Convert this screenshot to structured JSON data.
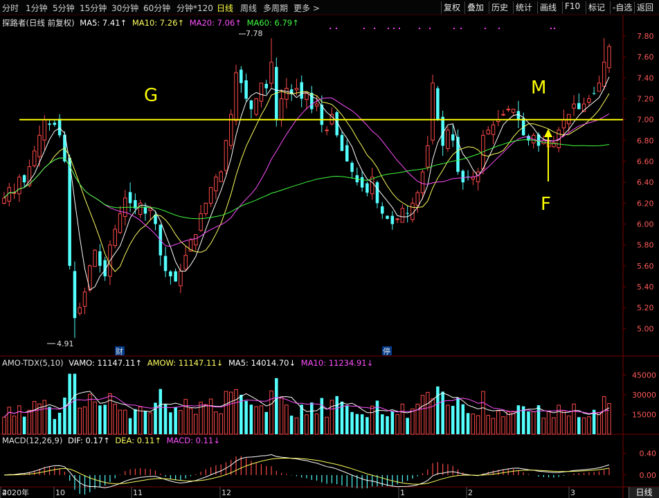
{
  "toolbar": {
    "periods": [
      "分时",
      "1分钟",
      "5分钟",
      "15分钟",
      "30分钟",
      "60分钟",
      "分钟*120",
      "日线",
      "周线",
      "多周期",
      "更多 >"
    ],
    "active": "日线",
    "right": [
      "复权",
      "叠加",
      "历史",
      "统计",
      "画线",
      "F10",
      "标记",
      "-自选",
      "返回"
    ]
  },
  "main_legend": {
    "title": "探路者(日线 前复权)",
    "ma5": "MA5: 7.41↑",
    "ma10": "MA10: 7.26↑",
    "ma20": "MA20: 7.06↑",
    "ma60": "MA60: 6.79↑"
  },
  "volume_legend": {
    "title": "AMO-TDX(5,10)",
    "vamo": "VAMO: 11147.11↑",
    "amow": "AMOW: 11147.11↓",
    "ma5": "MA5: 14014.70↓",
    "ma10": "MA10: 11234.91↓"
  },
  "macd_legend": {
    "title": "MACD(12,26,9)",
    "dif": "DIF: 0.17↑",
    "dea": "DEA: 0.11↑",
    "macd": "MACD: 0.11↓"
  },
  "annotations": {
    "G": "G",
    "M": "M",
    "F": "F",
    "high": "7.78",
    "low": "4.91",
    "cai": "财",
    "ting": "停"
  },
  "footer_tab": "日线",
  "colors": {
    "up": "#ff4a4a",
    "down": "#54ffff",
    "ma5": "#ffffff",
    "ma10": "#ffff60",
    "ma20": "#ff50ff",
    "ma60": "#40ff40",
    "grid": "#7a0000",
    "level": "#ffff00"
  },
  "chart_data": {
    "type": "candlestick",
    "ylim": [
      4.75,
      7.9
    ],
    "yticks": [
      "7.80",
      "7.60",
      "7.40",
      "7.20",
      "7.00",
      "6.80",
      "6.60",
      "6.40",
      "6.20",
      "6.00",
      "5.80",
      "5.60",
      "5.40",
      "5.20",
      "5.00"
    ],
    "horizontal_level": 7.0,
    "x_axis_labels": [
      "2020年",
      "10",
      "11",
      "12",
      "1",
      "2",
      "3",
      "4"
    ],
    "closes": [
      6.25,
      6.35,
      6.3,
      6.45,
      6.4,
      6.55,
      6.7,
      6.85,
      7.0,
      6.95,
      6.95,
      6.85,
      6.6,
      5.6,
      5.1,
      5.2,
      5.35,
      5.6,
      5.75,
      5.6,
      5.5,
      5.8,
      5.95,
      6.1,
      6.25,
      6.2,
      6.15,
      6.2,
      6.1,
      6.15,
      6.0,
      5.7,
      5.55,
      5.5,
      5.45,
      5.55,
      5.7,
      5.85,
      5.9,
      6.1,
      6.2,
      6.35,
      6.45,
      6.5,
      6.8,
      7.05,
      7.45,
      7.35,
      7.2,
      7.1,
      7.2,
      7.35,
      7.3,
      7.55,
      7.0,
      7.2,
      7.3,
      7.25,
      7.3,
      7.2,
      7.25,
      7.1,
      7.15,
      6.95,
      6.9,
      7.05,
      6.85,
      6.7,
      6.6,
      6.5,
      6.4,
      6.35,
      6.3,
      6.45,
      6.2,
      6.1,
      6.05,
      6.0,
      6.05,
      6.15,
      6.1,
      6.2,
      6.3,
      6.5,
      6.75,
      7.35,
      7.0,
      6.75,
      6.9,
      6.8,
      6.5,
      6.4,
      6.45,
      6.45,
      6.5,
      6.85,
      6.9,
      6.95,
      7.0,
      7.05,
      7.1,
      7.1,
      7.0,
      6.85,
      6.8,
      6.85,
      6.75,
      6.8,
      6.8,
      6.78,
      6.9,
      7.0,
      7.05,
      7.15,
      7.1,
      7.15,
      7.2,
      7.25,
      7.35,
      7.55,
      7.7
    ],
    "volume_ylim": [
      0,
      50000
    ],
    "volume_yticks": [
      "45000",
      "30000",
      "15000"
    ],
    "macd_ylim": [
      -0.22,
      0.55
    ],
    "macd_yticks": [
      "0.40",
      "0.00"
    ]
  }
}
